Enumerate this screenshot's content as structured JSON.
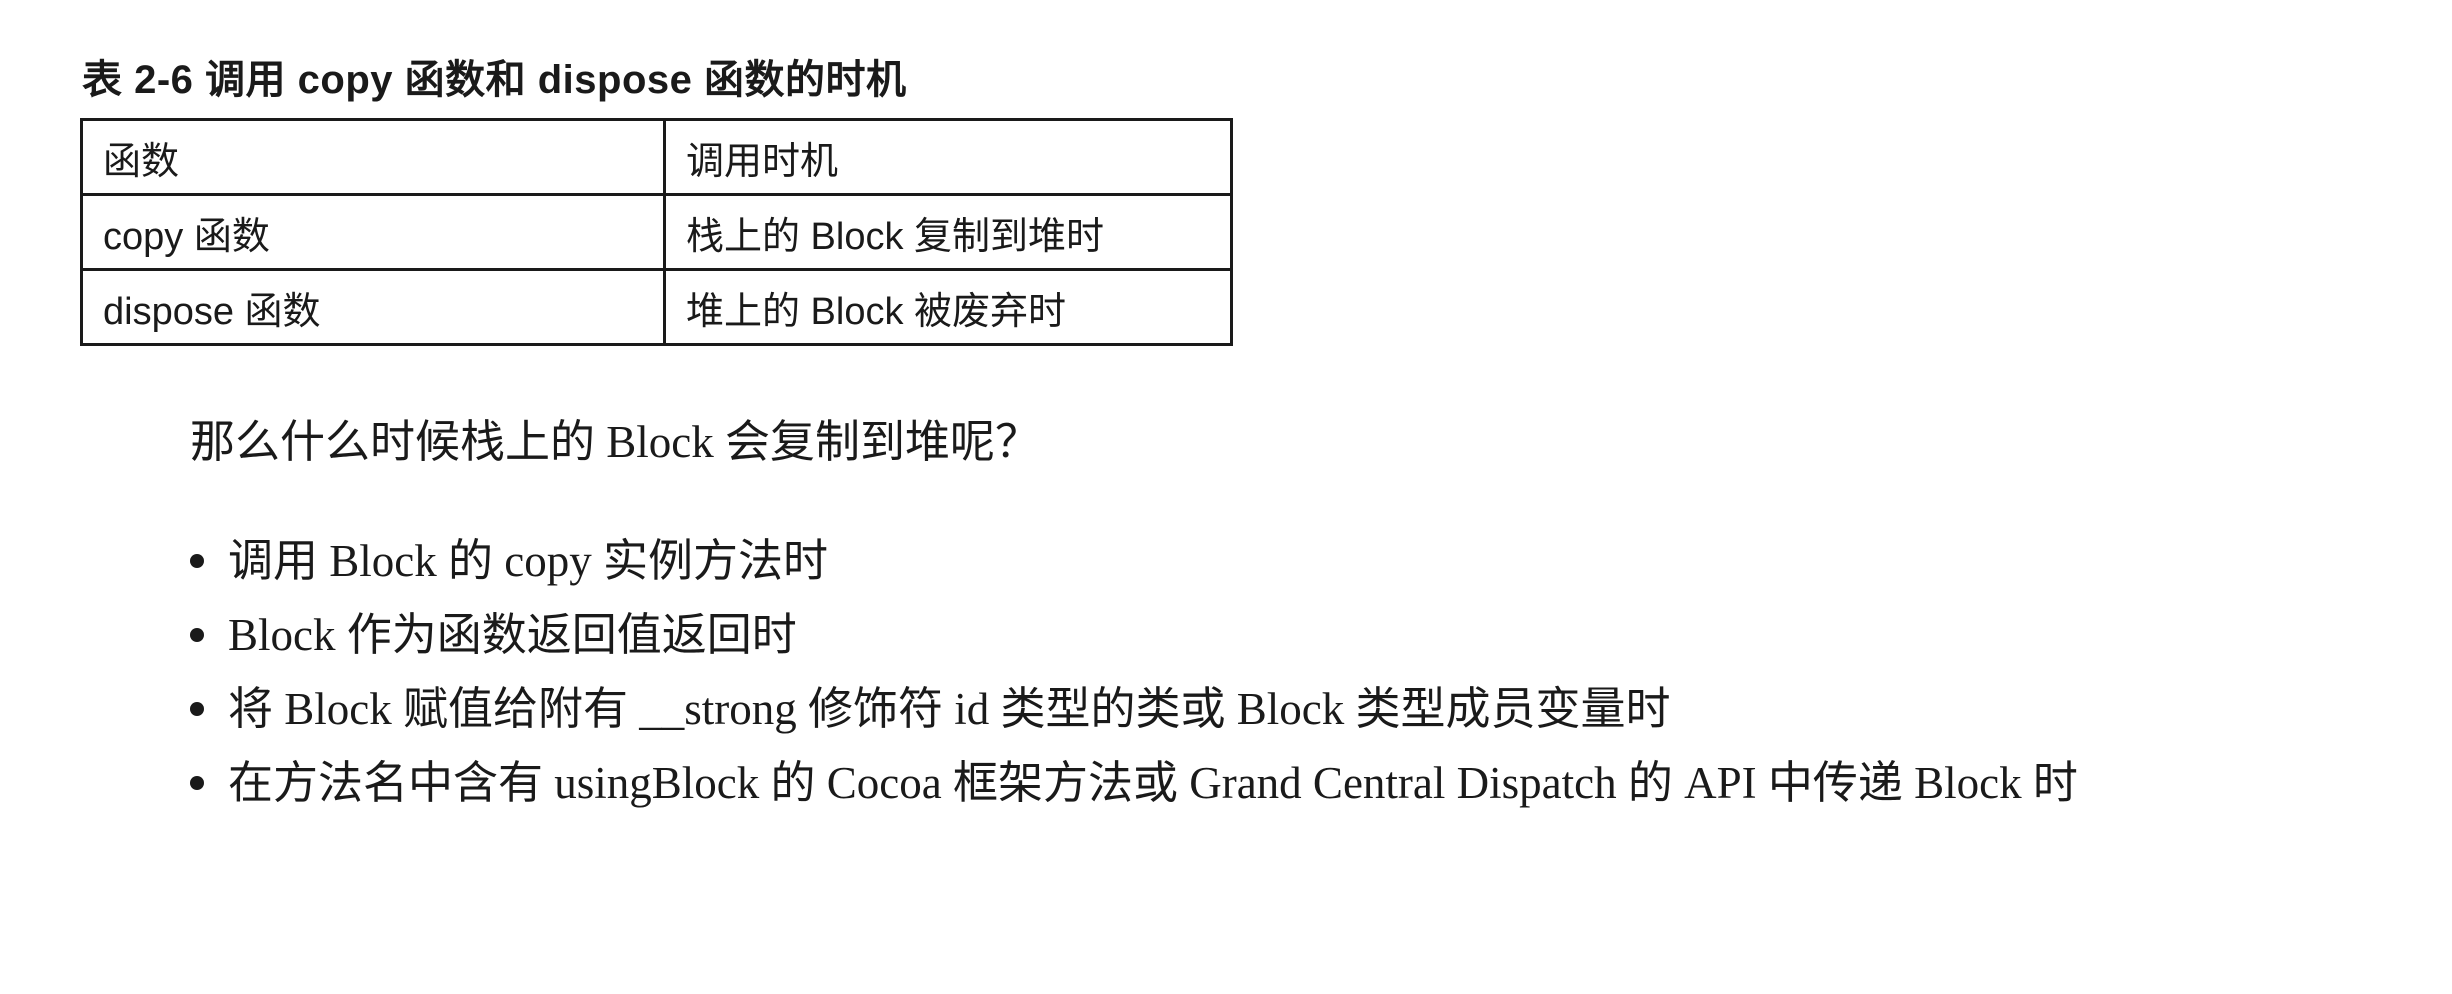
{
  "caption": "表 2-6   调用 copy 函数和 dispose 函数的时机",
  "table": {
    "headers": [
      "函数",
      "调用时机"
    ],
    "rows": [
      [
        "copy 函数",
        "栈上的 Block 复制到堆时"
      ],
      [
        "dispose 函数",
        "堆上的 Block 被废弃时"
      ]
    ]
  },
  "question": "那么什么时候栈上的 Block 会复制到堆呢？",
  "cases": [
    "调用 Block 的 copy 实例方法时",
    "Block 作为函数返回值返回时",
    "将 Block 赋值给附有 __strong 修饰符 id 类型的类或 Block 类型成员变量时",
    "在方法名中含有 usingBlock 的 Cocoa 框架方法或 Grand Central Dispatch 的 API 中传递 Block 时"
  ]
}
